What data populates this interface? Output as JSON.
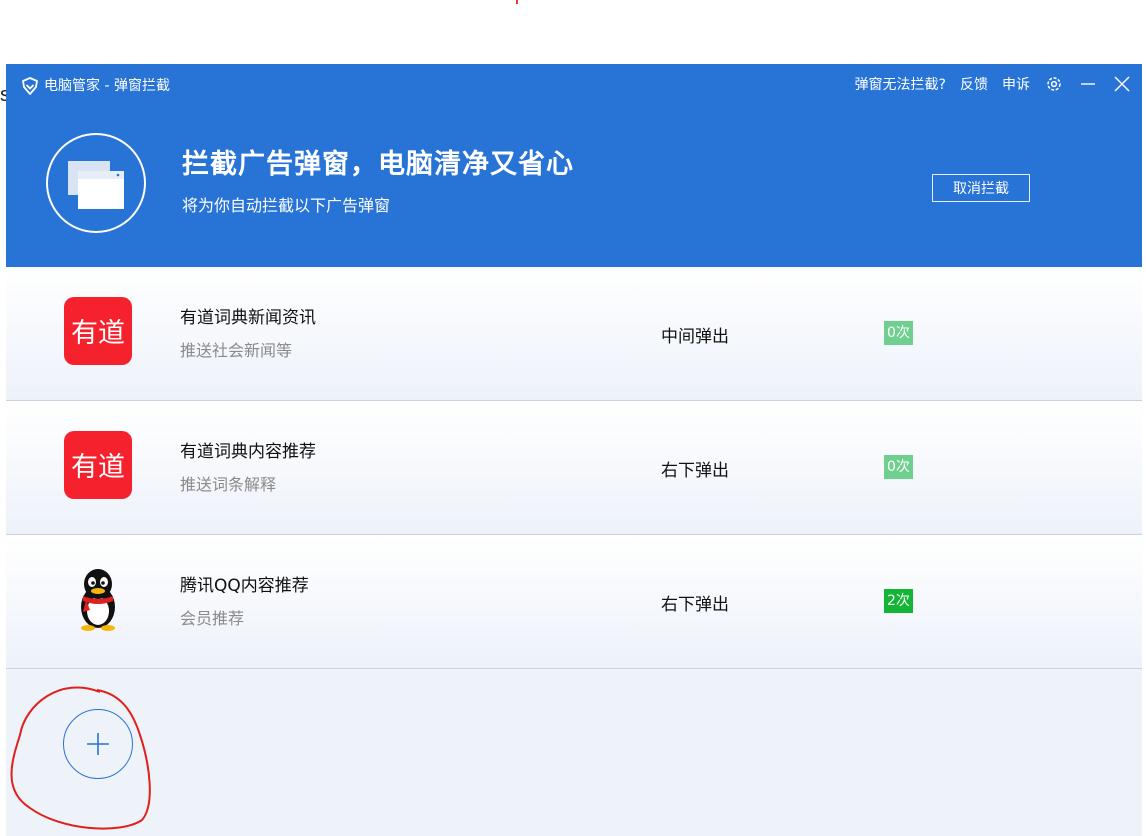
{
  "window": {
    "title": "电脑管家 - 弹窗拦截",
    "links": [
      "弹窗无法拦截?",
      "反馈",
      "申诉"
    ],
    "icons": [
      "settings-icon",
      "minimize-icon",
      "close-icon"
    ]
  },
  "stray_text": "s",
  "header": {
    "headline": "拦截广告弹窗，电脑清净又省心",
    "subtitle": "将为你自动拦截以下广告弹窗",
    "cancel_label": "取消拦截"
  },
  "items": [
    {
      "icon_text": "有道",
      "name": "有道词典新闻资讯",
      "desc": "推送社会新闻等",
      "mode": "中间弹出",
      "count": "0次"
    },
    {
      "icon_text": "有道",
      "name": "有道词典内容推荐",
      "desc": "推送词条解释",
      "mode": "右下弹出",
      "count": "0次"
    },
    {
      "icon_text": "",
      "name": "腾讯QQ内容推荐",
      "desc": "会员推荐",
      "mode": "右下弹出",
      "count": "2次"
    }
  ],
  "colors": {
    "primary": "#2773d6",
    "count_zero": "#6fcf8e",
    "count_nonzero": "#12b634",
    "youdao_red": "#f5222d",
    "annotation": "#e0201c"
  }
}
